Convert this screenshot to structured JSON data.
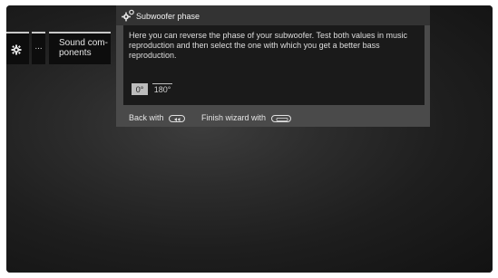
{
  "menu": {
    "tiles": [
      {
        "icon": "gear-icon",
        "label": ""
      },
      {
        "label": "..."
      },
      {
        "label_lines": [
          "Sound com-",
          "ponents"
        ]
      }
    ]
  },
  "dialog": {
    "icon": "gears-icon",
    "title": "Subwoofer phase",
    "description": "Here you can reverse the phase of your subwoofer. Test both values in music reproduction and then select the one with which you get a better bass reproduction.",
    "options": [
      {
        "label": "0°",
        "selected": true
      },
      {
        "label": "180°",
        "selected": false
      }
    ],
    "footer": {
      "back_label": "Back with",
      "back_key_icon": "back-key-icon",
      "finish_label": "Finish wizard with",
      "finish_key_icon": "exit-key-icon"
    }
  },
  "colors": {
    "background_dark": "#1e1e1e",
    "dialog_frame": "#4a4a4a",
    "dialog_body": "#1a1a1a",
    "selected_option": "#bcbcbc"
  }
}
